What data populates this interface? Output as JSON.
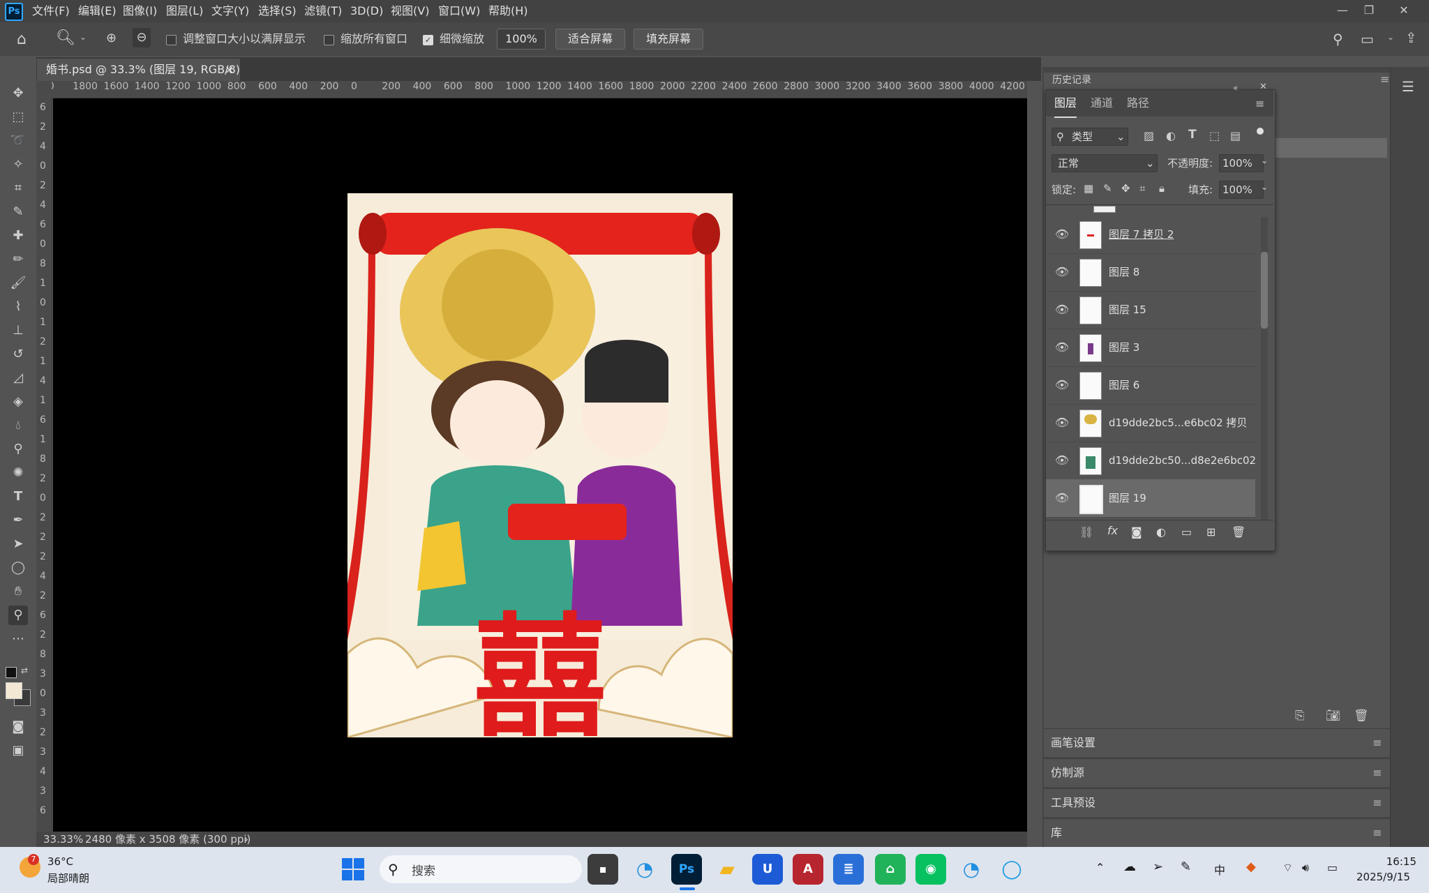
{
  "app": {
    "logo": "Ps"
  },
  "menu": [
    "文件(F)",
    "编辑(E)",
    "图像(I)",
    "图层(L)",
    "文字(Y)",
    "选择(S)",
    "滤镜(T)",
    "3D(D)",
    "视图(V)",
    "窗口(W)",
    "帮助(H)"
  ],
  "options": {
    "resize_windows": "调整窗口大小以满屏显示",
    "zoom_all": "缩放所有窗口",
    "scrubby_zoom": "细微缩放",
    "zoom_value": "100%",
    "fit_screen": "适合屏幕",
    "fill_screen": "填充屏幕"
  },
  "document_tab": {
    "title": "婚书.psd @ 33.3% (图层 19, RGB/8)",
    "close": "×"
  },
  "ruler": {
    "h_ticks": [
      "00",
      "1800",
      "1600",
      "1400",
      "1200",
      "1000",
      "800",
      "600",
      "400",
      "200",
      "0",
      "200",
      "400",
      "600",
      "800",
      "1000",
      "1200",
      "1400",
      "1600",
      "1800",
      "2000",
      "2200",
      "2400",
      "2600",
      "2800",
      "3000",
      "3200",
      "3400",
      "3600",
      "3800",
      "4000",
      "4200"
    ],
    "v_ticks": [
      "6",
      "2",
      "4",
      "0",
      "2",
      "4",
      "6",
      "0",
      "8",
      "1",
      "0",
      "1",
      "2",
      "1",
      "4",
      "1",
      "6",
      "1",
      "8",
      "2",
      "0",
      "2",
      "2",
      "2",
      "4",
      "2",
      "6",
      "2",
      "8",
      "3",
      "0",
      "3",
      "2",
      "3",
      "4",
      "3",
      "6"
    ]
  },
  "artwork": {
    "double_happiness": "囍"
  },
  "status": {
    "zoom": "33.33%",
    "doc_info": "2480 像素 x 3508 像素 (300 ppi)",
    "arrow": "›"
  },
  "history_panel": {
    "title": "历史记录"
  },
  "layers_panel": {
    "tabs": [
      "图层",
      "通道",
      "路径"
    ],
    "filter_kind": "类型",
    "blend_mode": "正常",
    "opacity_label": "不透明度:",
    "opacity_value": "100%",
    "lock_label": "锁定:",
    "fill_label": "填充:",
    "fill_value": "100%",
    "layers": [
      {
        "name": "图层 7 拷贝 2",
        "selected": false
      },
      {
        "name": "图层 8",
        "selected": false
      },
      {
        "name": "图层 15",
        "selected": false
      },
      {
        "name": "图层 3",
        "selected": false
      },
      {
        "name": "图层 6",
        "selected": false
      },
      {
        "name": "d19dde2bc5...e6bc02 拷贝",
        "selected": false
      },
      {
        "name": "d19dde2bc50...d8e2e6bc02",
        "selected": false
      },
      {
        "name": "图层 19",
        "selected": true
      }
    ],
    "bottom_icons": [
      "link-icon",
      "fx-icon",
      "mask-icon",
      "adjustment-icon",
      "group-icon",
      "new-layer-icon",
      "trash-icon"
    ],
    "fx_text": "fx"
  },
  "collapsed_panels": [
    "画笔设置",
    "仿制源",
    "工具预设",
    "库"
  ],
  "taskbar": {
    "weather_temp": "36°C",
    "weather_desc": "局部晴朗",
    "weather_badge": "7",
    "search_placeholder": "搜索",
    "time": "16:15",
    "date": "2025/9/15",
    "ps_label": "Ps",
    "ime": "中"
  },
  "colors": {
    "accent": "#31a8ff",
    "menubar": "#424242",
    "panel": "#535353",
    "canvas": "#000000",
    "taskbar": "#dde4ee"
  }
}
